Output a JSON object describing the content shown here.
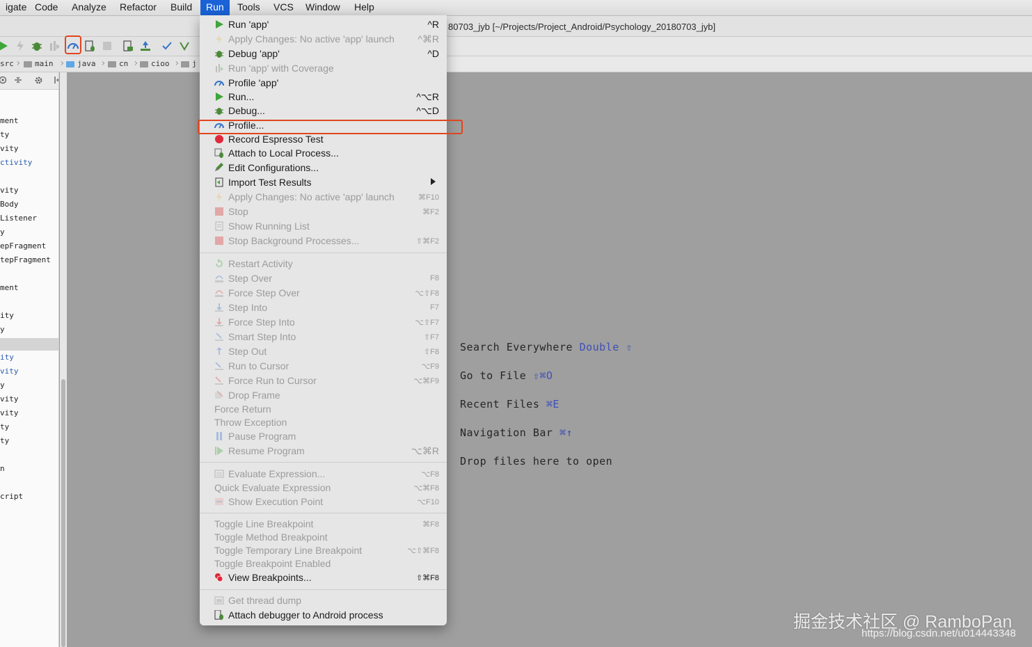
{
  "menubar": {
    "items": [
      "igate",
      "Code",
      "Analyze",
      "Refactor",
      "Build",
      "Run",
      "Tools",
      "VCS",
      "Window",
      "Help"
    ],
    "active": "Run"
  },
  "window": {
    "title": "80703_jyb [~/Projects/Project_Android/Psychology_20180703_jyb]"
  },
  "breadcrumb": [
    "src",
    "main",
    "java",
    "cn",
    "cioo",
    "j"
  ],
  "project_tree": [
    "ment",
    "ty",
    "vity",
    "ctivity",
    "vity",
    "Body",
    "Listener",
    "y",
    "epFragment",
    "tepFragment",
    "ment",
    "ity",
    "y",
    "ity",
    "vity",
    "y",
    "vity",
    "vity",
    "ty",
    "ty",
    "n",
    "cript"
  ],
  "welcome": {
    "hints": [
      {
        "text": "Search Everywhere",
        "key": "Double ⇧"
      },
      {
        "text": "Go to File",
        "key": "⇧⌘O"
      },
      {
        "text": "Recent Files",
        "key": "⌘E"
      },
      {
        "text": "Navigation Bar",
        "key": "⌘↑"
      },
      {
        "text": "Drop files here to open",
        "key": ""
      }
    ]
  },
  "run_menu": {
    "items": [
      {
        "label": "Run 'app'",
        "shortcut": "^R",
        "icon": "run-icon",
        "enabled": true
      },
      {
        "label": "Apply Changes: No active 'app' launch",
        "shortcut": "^⌘R",
        "icon": "apply-changes-icon",
        "enabled": false
      },
      {
        "label": "Debug 'app'",
        "shortcut": "^D",
        "icon": "debug-icon",
        "enabled": true
      },
      {
        "label": "Run 'app' with Coverage",
        "shortcut": "",
        "icon": "coverage-icon",
        "enabled": false
      },
      {
        "label": "Profile 'app'",
        "shortcut": "",
        "icon": "profile-icon",
        "enabled": true
      },
      {
        "label": "Run...",
        "shortcut": "^⌥R",
        "icon": "run-icon",
        "enabled": true
      },
      {
        "label": "Debug...",
        "shortcut": "^⌥D",
        "icon": "debug-icon",
        "enabled": true
      },
      {
        "label": "Profile...",
        "shortcut": "",
        "icon": "profile-icon",
        "enabled": true
      },
      {
        "label": "Record Espresso Test",
        "shortcut": "",
        "icon": "record-icon",
        "enabled": true
      },
      {
        "label": "Attach to Local Process...",
        "shortcut": "",
        "icon": "attach-process-icon",
        "enabled": true
      },
      {
        "label": "Edit Configurations...",
        "shortcut": "",
        "icon": "edit-config-icon",
        "enabled": true
      },
      {
        "label": "Import Test Results",
        "shortcut": "",
        "icon": "import-tests-icon",
        "enabled": true,
        "submenu": true
      },
      {
        "label": "Apply Changes: No active 'app' launch",
        "shortcut": "⌘F10",
        "icon": "apply-changes-icon",
        "enabled": false
      },
      {
        "label": "Stop",
        "shortcut": "⌘F2",
        "icon": "stop-icon",
        "enabled": false
      },
      {
        "label": "Show Running List",
        "shortcut": "",
        "icon": "running-list-icon",
        "enabled": false
      },
      {
        "label": "Stop Background Processes...",
        "shortcut": "⇧⌘F2",
        "icon": "stop-bg-icon",
        "enabled": false
      },
      {
        "label": "Restart Activity",
        "shortcut": "",
        "icon": "restart-icon",
        "enabled": false
      },
      {
        "label": "Step Over",
        "shortcut": "F8",
        "icon": "step-over-icon",
        "enabled": false
      },
      {
        "label": "Force Step Over",
        "shortcut": "⌥⇧F8",
        "icon": "force-step-over-icon",
        "enabled": false
      },
      {
        "label": "Step Into",
        "shortcut": "F7",
        "icon": "step-into-icon",
        "enabled": false
      },
      {
        "label": "Force Step Into",
        "shortcut": "⌥⇧F7",
        "icon": "force-step-into-icon",
        "enabled": false
      },
      {
        "label": "Smart Step Into",
        "shortcut": "⇧F7",
        "icon": "smart-step-into-icon",
        "enabled": false
      },
      {
        "label": "Step Out",
        "shortcut": "⇧F8",
        "icon": "step-out-icon",
        "enabled": false
      },
      {
        "label": "Run to Cursor",
        "shortcut": "⌥F9",
        "icon": "run-to-cursor-icon",
        "enabled": false
      },
      {
        "label": "Force Run to Cursor",
        "shortcut": "⌥⌘F9",
        "icon": "force-run-to-cursor-icon",
        "enabled": false
      },
      {
        "label": "Drop Frame",
        "shortcut": "",
        "icon": "drop-frame-icon",
        "enabled": false
      },
      {
        "label": "Force Return",
        "shortcut": "",
        "icon": "",
        "enabled": false
      },
      {
        "label": "Throw Exception",
        "shortcut": "",
        "icon": "",
        "enabled": false
      },
      {
        "label": "Pause Program",
        "shortcut": "",
        "icon": "pause-icon",
        "enabled": false
      },
      {
        "label": "Resume Program",
        "shortcut": "⌥⌘R",
        "icon": "resume-icon",
        "enabled": false
      },
      {
        "label": "Evaluate Expression...",
        "shortcut": "⌥F8",
        "icon": "evaluate-icon",
        "enabled": false
      },
      {
        "label": "Quick Evaluate Expression",
        "shortcut": "⌥⌘F8",
        "icon": "",
        "enabled": false
      },
      {
        "label": "Show Execution Point",
        "shortcut": "⌥F10",
        "icon": "execution-point-icon",
        "enabled": false
      },
      {
        "label": "Toggle Line Breakpoint",
        "shortcut": "⌘F8",
        "icon": "",
        "enabled": false
      },
      {
        "label": "Toggle Method Breakpoint",
        "shortcut": "",
        "icon": "",
        "enabled": false
      },
      {
        "label": "Toggle Temporary Line Breakpoint",
        "shortcut": "⌥⇧⌘F8",
        "icon": "",
        "enabled": false
      },
      {
        "label": "Toggle Breakpoint Enabled",
        "shortcut": "",
        "icon": "",
        "enabled": false
      },
      {
        "label": "View Breakpoints...",
        "shortcut": "⇧⌘F8",
        "icon": "breakpoints-icon",
        "enabled": true
      },
      {
        "label": "Get thread dump",
        "shortcut": "",
        "icon": "thread-dump-icon",
        "enabled": false
      },
      {
        "label": "Attach debugger to Android process",
        "shortcut": "",
        "icon": "attach-debugger-icon",
        "enabled": true
      }
    ]
  },
  "watermark": {
    "text": "掘金技术社区 @ RamboPan",
    "url": "https://blog.csdn.net/u014443348"
  },
  "colors": {
    "accent": "#1a62d6",
    "highlight": "#e0461f",
    "run_green": "#3fa63a",
    "record_red": "#e0283a"
  }
}
